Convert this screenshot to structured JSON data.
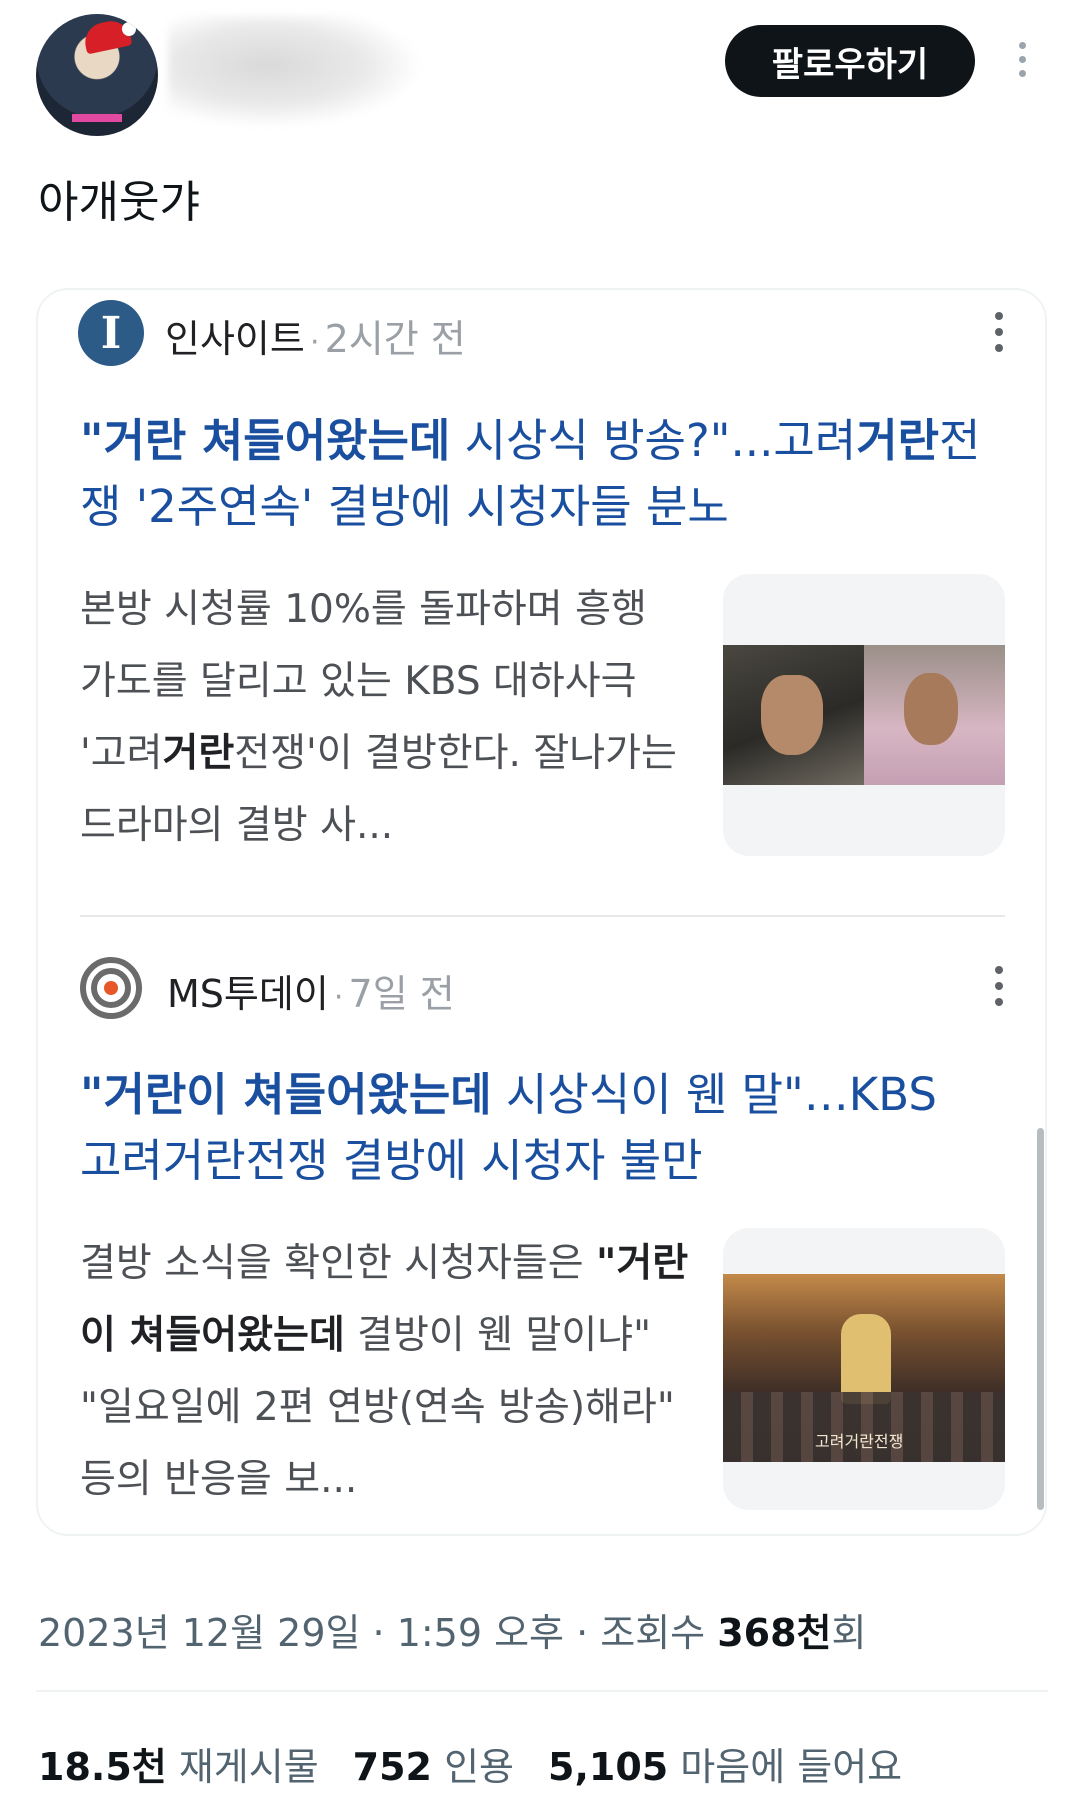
{
  "header": {
    "follow_label": "팔로우하기"
  },
  "tweet": {
    "text": "아개웃갸"
  },
  "card": {
    "articles": [
      {
        "source": "인사이트",
        "logo_letter": "I",
        "dot": "·",
        "time": "2시간 전",
        "headline_hl1": "\"거란 쳐들어왔는데",
        "headline_mid": " 시상식 방송?\"...고려",
        "headline_hl2": "거란",
        "headline_end": "전쟁 '2주연속' 결방에 시청자들 분노",
        "snippet_pre": "본방 시청률 10%를 돌파하며 흥행 가도를 달리고 있는 KBS 대하사극 '고려",
        "snippet_hl": "거란",
        "snippet_post": "전쟁'이 결방한다. 잘나가는 드라마의 결방 사..."
      },
      {
        "source": "MS투데이",
        "dot": "·",
        "time": "7일 전",
        "headline_hl1": "\"거란이 쳐들어왔는데",
        "headline_end": " 시상식이 웬 말\"…KBS 고려거란전쟁 결방에 시청자 불만",
        "snippet_pre": "결방 소식을 확인한 시청자들은 ",
        "snippet_hl": "\"거란이 쳐들어왔는데",
        "snippet_post": " 결방이 웬 말이냐\" \"일요일에 2편 연방(연속 방송)해라\" 등의 반응을 보...",
        "image_caption": "고려거란전쟁"
      }
    ]
  },
  "meta": {
    "datetime": "2023년 12월 29일 · 1:59 오후 · 조회수 ",
    "views": "368천",
    "views_suffix": "회"
  },
  "stats": {
    "retweets_count": "18.5천",
    "retweets_label": "재게시물",
    "quotes_count": "752",
    "quotes_label": "인용",
    "likes_count": "5,105",
    "likes_label": "마음에 들어요"
  },
  "colors": {
    "accent_headline": "#1a4fa0",
    "button_bg": "#0f1419"
  }
}
